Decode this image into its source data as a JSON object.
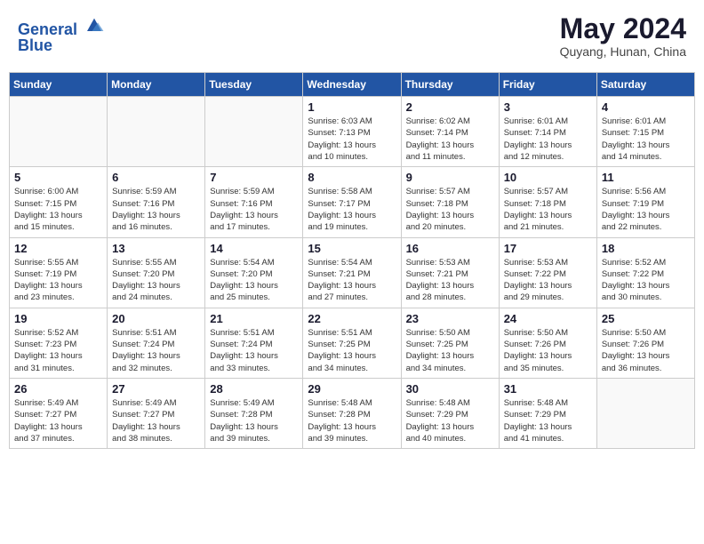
{
  "header": {
    "logo_line1": "General",
    "logo_line2": "Blue",
    "month": "May 2024",
    "location": "Quyang, Hunan, China"
  },
  "weekdays": [
    "Sunday",
    "Monday",
    "Tuesday",
    "Wednesday",
    "Thursday",
    "Friday",
    "Saturday"
  ],
  "weeks": [
    [
      {
        "day": "",
        "info": ""
      },
      {
        "day": "",
        "info": ""
      },
      {
        "day": "",
        "info": ""
      },
      {
        "day": "1",
        "info": "Sunrise: 6:03 AM\nSunset: 7:13 PM\nDaylight: 13 hours\nand 10 minutes."
      },
      {
        "day": "2",
        "info": "Sunrise: 6:02 AM\nSunset: 7:14 PM\nDaylight: 13 hours\nand 11 minutes."
      },
      {
        "day": "3",
        "info": "Sunrise: 6:01 AM\nSunset: 7:14 PM\nDaylight: 13 hours\nand 12 minutes."
      },
      {
        "day": "4",
        "info": "Sunrise: 6:01 AM\nSunset: 7:15 PM\nDaylight: 13 hours\nand 14 minutes."
      }
    ],
    [
      {
        "day": "5",
        "info": "Sunrise: 6:00 AM\nSunset: 7:15 PM\nDaylight: 13 hours\nand 15 minutes."
      },
      {
        "day": "6",
        "info": "Sunrise: 5:59 AM\nSunset: 7:16 PM\nDaylight: 13 hours\nand 16 minutes."
      },
      {
        "day": "7",
        "info": "Sunrise: 5:59 AM\nSunset: 7:16 PM\nDaylight: 13 hours\nand 17 minutes."
      },
      {
        "day": "8",
        "info": "Sunrise: 5:58 AM\nSunset: 7:17 PM\nDaylight: 13 hours\nand 19 minutes."
      },
      {
        "day": "9",
        "info": "Sunrise: 5:57 AM\nSunset: 7:18 PM\nDaylight: 13 hours\nand 20 minutes."
      },
      {
        "day": "10",
        "info": "Sunrise: 5:57 AM\nSunset: 7:18 PM\nDaylight: 13 hours\nand 21 minutes."
      },
      {
        "day": "11",
        "info": "Sunrise: 5:56 AM\nSunset: 7:19 PM\nDaylight: 13 hours\nand 22 minutes."
      }
    ],
    [
      {
        "day": "12",
        "info": "Sunrise: 5:55 AM\nSunset: 7:19 PM\nDaylight: 13 hours\nand 23 minutes."
      },
      {
        "day": "13",
        "info": "Sunrise: 5:55 AM\nSunset: 7:20 PM\nDaylight: 13 hours\nand 24 minutes."
      },
      {
        "day": "14",
        "info": "Sunrise: 5:54 AM\nSunset: 7:20 PM\nDaylight: 13 hours\nand 25 minutes."
      },
      {
        "day": "15",
        "info": "Sunrise: 5:54 AM\nSunset: 7:21 PM\nDaylight: 13 hours\nand 27 minutes."
      },
      {
        "day": "16",
        "info": "Sunrise: 5:53 AM\nSunset: 7:21 PM\nDaylight: 13 hours\nand 28 minutes."
      },
      {
        "day": "17",
        "info": "Sunrise: 5:53 AM\nSunset: 7:22 PM\nDaylight: 13 hours\nand 29 minutes."
      },
      {
        "day": "18",
        "info": "Sunrise: 5:52 AM\nSunset: 7:22 PM\nDaylight: 13 hours\nand 30 minutes."
      }
    ],
    [
      {
        "day": "19",
        "info": "Sunrise: 5:52 AM\nSunset: 7:23 PM\nDaylight: 13 hours\nand 31 minutes."
      },
      {
        "day": "20",
        "info": "Sunrise: 5:51 AM\nSunset: 7:24 PM\nDaylight: 13 hours\nand 32 minutes."
      },
      {
        "day": "21",
        "info": "Sunrise: 5:51 AM\nSunset: 7:24 PM\nDaylight: 13 hours\nand 33 minutes."
      },
      {
        "day": "22",
        "info": "Sunrise: 5:51 AM\nSunset: 7:25 PM\nDaylight: 13 hours\nand 34 minutes."
      },
      {
        "day": "23",
        "info": "Sunrise: 5:50 AM\nSunset: 7:25 PM\nDaylight: 13 hours\nand 34 minutes."
      },
      {
        "day": "24",
        "info": "Sunrise: 5:50 AM\nSunset: 7:26 PM\nDaylight: 13 hours\nand 35 minutes."
      },
      {
        "day": "25",
        "info": "Sunrise: 5:50 AM\nSunset: 7:26 PM\nDaylight: 13 hours\nand 36 minutes."
      }
    ],
    [
      {
        "day": "26",
        "info": "Sunrise: 5:49 AM\nSunset: 7:27 PM\nDaylight: 13 hours\nand 37 minutes."
      },
      {
        "day": "27",
        "info": "Sunrise: 5:49 AM\nSunset: 7:27 PM\nDaylight: 13 hours\nand 38 minutes."
      },
      {
        "day": "28",
        "info": "Sunrise: 5:49 AM\nSunset: 7:28 PM\nDaylight: 13 hours\nand 39 minutes."
      },
      {
        "day": "29",
        "info": "Sunrise: 5:48 AM\nSunset: 7:28 PM\nDaylight: 13 hours\nand 39 minutes."
      },
      {
        "day": "30",
        "info": "Sunrise: 5:48 AM\nSunset: 7:29 PM\nDaylight: 13 hours\nand 40 minutes."
      },
      {
        "day": "31",
        "info": "Sunrise: 5:48 AM\nSunset: 7:29 PM\nDaylight: 13 hours\nand 41 minutes."
      },
      {
        "day": "",
        "info": ""
      }
    ]
  ]
}
